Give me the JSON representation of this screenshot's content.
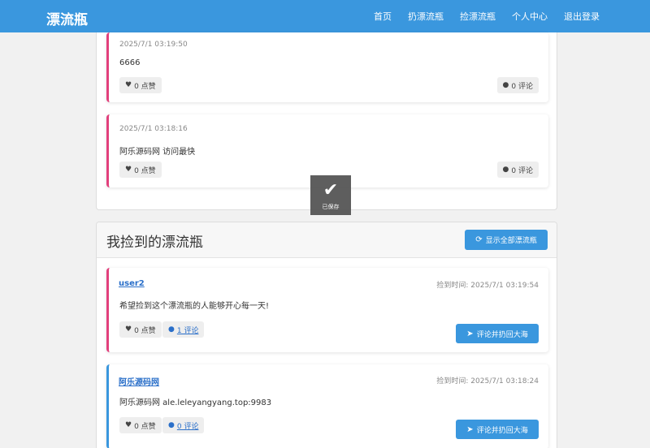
{
  "navbar": {
    "brand": "漂流瓶",
    "items": [
      "首页",
      "扔漂流瓶",
      "捡漂流瓶",
      "个人中心",
      "退出登录"
    ]
  },
  "my_bottles": [
    {
      "time": "2025/7/1 03:19:50",
      "content": "6666",
      "likes": "0 点赞",
      "comments": "0 评论"
    },
    {
      "time": "2025/7/1 03:18:16",
      "content": "阿乐源码网 访问最快",
      "likes": "0 点赞",
      "comments": "0 评论"
    }
  ],
  "toast": {
    "icon": "check-icon",
    "text": "已保存"
  },
  "picked": {
    "title": "我捡到的漂流瓶",
    "show_all_label": "显示全部漂流瓶",
    "items": [
      {
        "user": "user2",
        "time": "捡到时间: 2025/7/1 03:19:54",
        "content": "希望捡到这个漂流瓶的人能够开心每一天!",
        "likes": "0 点赞",
        "comments": "1 评论",
        "action": "评论并扔回大海"
      },
      {
        "user": "阿乐源码网",
        "time": "捡到时间: 2025/7/1 03:18:24",
        "content": "阿乐源码网 ale.leleyangyang.top:9983",
        "likes": "0 点赞",
        "comments": "0 评论",
        "action": "评论并扔回大海"
      }
    ]
  },
  "colors": {
    "primary": "#3a97de",
    "pink_accent": "#e2407c",
    "blue_accent": "#3a97de"
  }
}
